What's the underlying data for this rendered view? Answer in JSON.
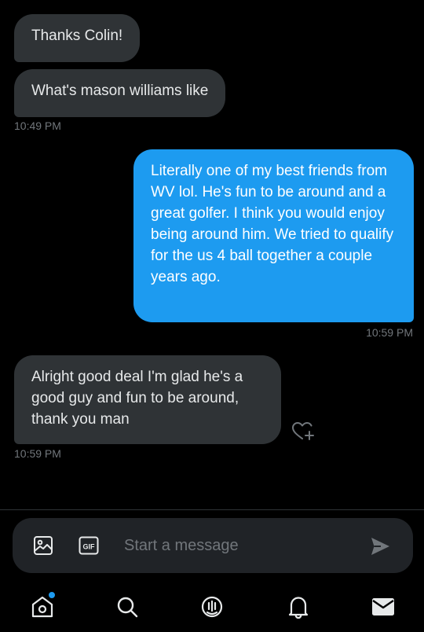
{
  "messages": [
    {
      "direction": "received",
      "text": "Thanks Colin!"
    },
    {
      "direction": "received",
      "text": "What's mason williams like"
    },
    {
      "direction": "sent",
      "text": "Literally one of my best friends from WV lol. He's fun to be around and a great golfer. I think you would enjoy being around him. We tried to qualify for the us 4 ball together a couple years ago."
    },
    {
      "direction": "received",
      "text": "Alright good deal I'm glad he's a good guy and fun to be around, thank you man"
    }
  ],
  "timestamps": [
    "10:49 PM",
    "10:59 PM",
    "10:59 PM"
  ],
  "composer": {
    "placeholder": "Start a message",
    "value": "",
    "gif_label": "GIF"
  },
  "icons": {
    "reaction": "heart-plus-icon",
    "image": "image-icon",
    "gif": "gif-icon",
    "send": "send-icon",
    "home": "home-icon",
    "search": "search-icon",
    "spaces": "spaces-icon",
    "notifications": "bell-icon",
    "messages": "mail-icon"
  },
  "nav": {
    "active": "messages",
    "home_has_badge_dot": true
  },
  "colors": {
    "background": "#000000",
    "received_bubble": "#2f3336",
    "sent_bubble": "#1d9bf0",
    "timestamp": "#71767b",
    "accent": "#1d9bf0"
  }
}
